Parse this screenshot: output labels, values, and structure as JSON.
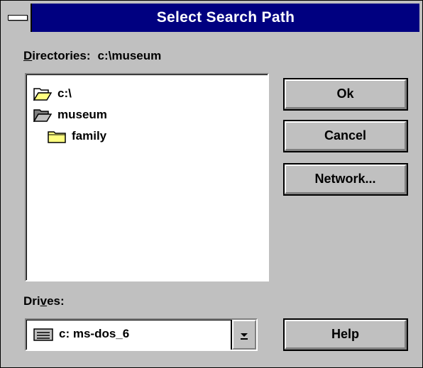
{
  "window": {
    "title": "Select Search Path"
  },
  "directories": {
    "label_mnemonic": "D",
    "label_rest": "irectories:",
    "current_path": "c:\\museum",
    "items": [
      {
        "label": "c:\\",
        "icon": "open-folder-icon"
      },
      {
        "label": "museum",
        "icon": "open-folder-icon"
      },
      {
        "label": "family",
        "icon": "closed-folder-icon"
      }
    ]
  },
  "drives": {
    "label_pre": "Dri",
    "label_mnemonic": "v",
    "label_post": "es:",
    "selected": "c: ms-dos_6",
    "icon": "hard-drive-icon"
  },
  "buttons": {
    "ok": "Ok",
    "cancel": "Cancel",
    "network": "Network...",
    "help": "Help"
  },
  "colors": {
    "title_bar": "#000080",
    "dialog_face": "#c0c0c0",
    "list_background": "#ffffff",
    "folder_fill": "#ffff80"
  }
}
